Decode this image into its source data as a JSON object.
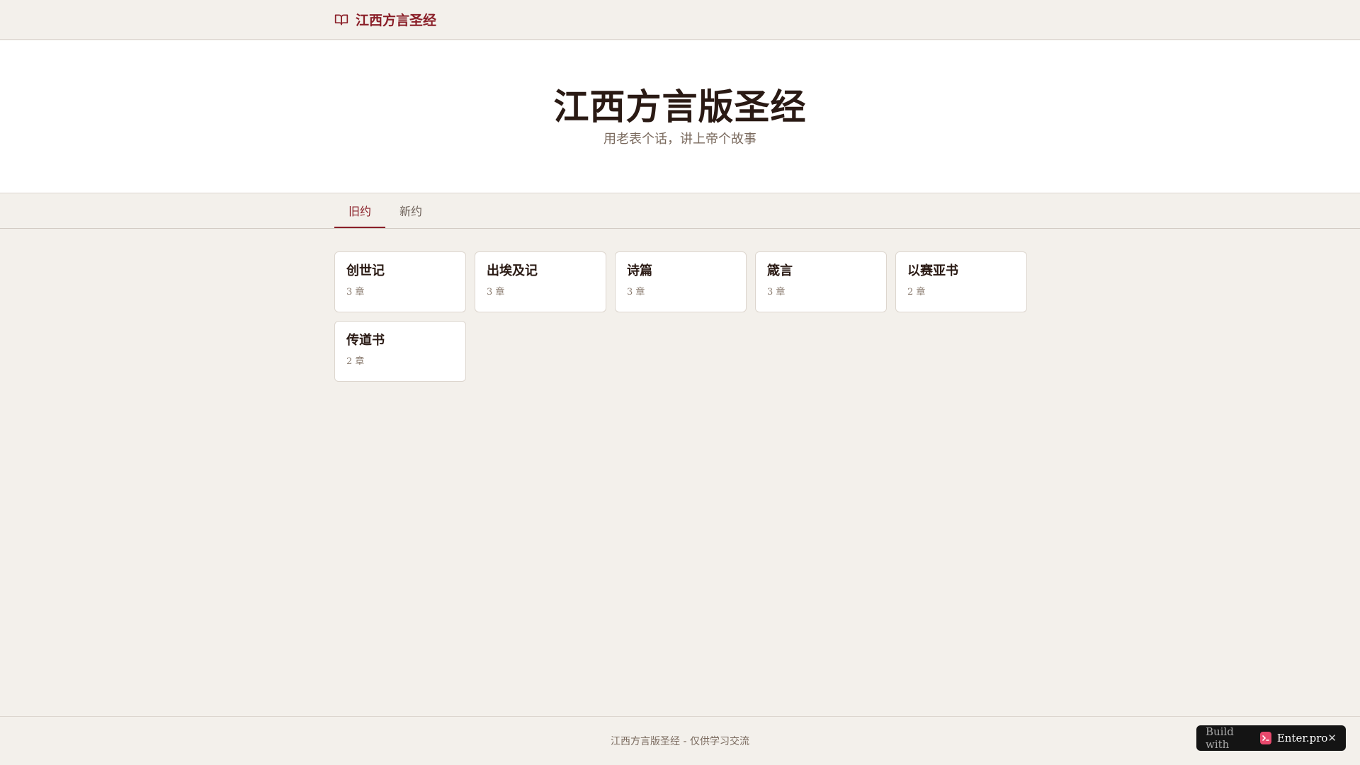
{
  "header": {
    "brand_icon": "book-open-icon",
    "brand_label": "江西方言圣经",
    "brand_color": "#8a1f28"
  },
  "hero": {
    "title": "江西方言版圣经",
    "subtitle": "用老表个话，讲上帝个故事"
  },
  "tabs": [
    {
      "label": "旧约",
      "active": true
    },
    {
      "label": "新约",
      "active": false
    }
  ],
  "books": [
    {
      "title": "创世记",
      "chapters": "3 章"
    },
    {
      "title": "出埃及记",
      "chapters": "3 章"
    },
    {
      "title": "诗篇",
      "chapters": "3 章"
    },
    {
      "title": "箴言",
      "chapters": "3 章"
    },
    {
      "title": "以赛亚书",
      "chapters": "2 章"
    },
    {
      "title": "传道书",
      "chapters": "2 章"
    }
  ],
  "footer": {
    "text": "江西方言版圣经 - 仅供学习交流"
  },
  "badge": {
    "prefix": "Build with",
    "brand": "Enter.pro",
    "logo_icon": "enter-logo-icon",
    "close_icon": "close-icon"
  }
}
